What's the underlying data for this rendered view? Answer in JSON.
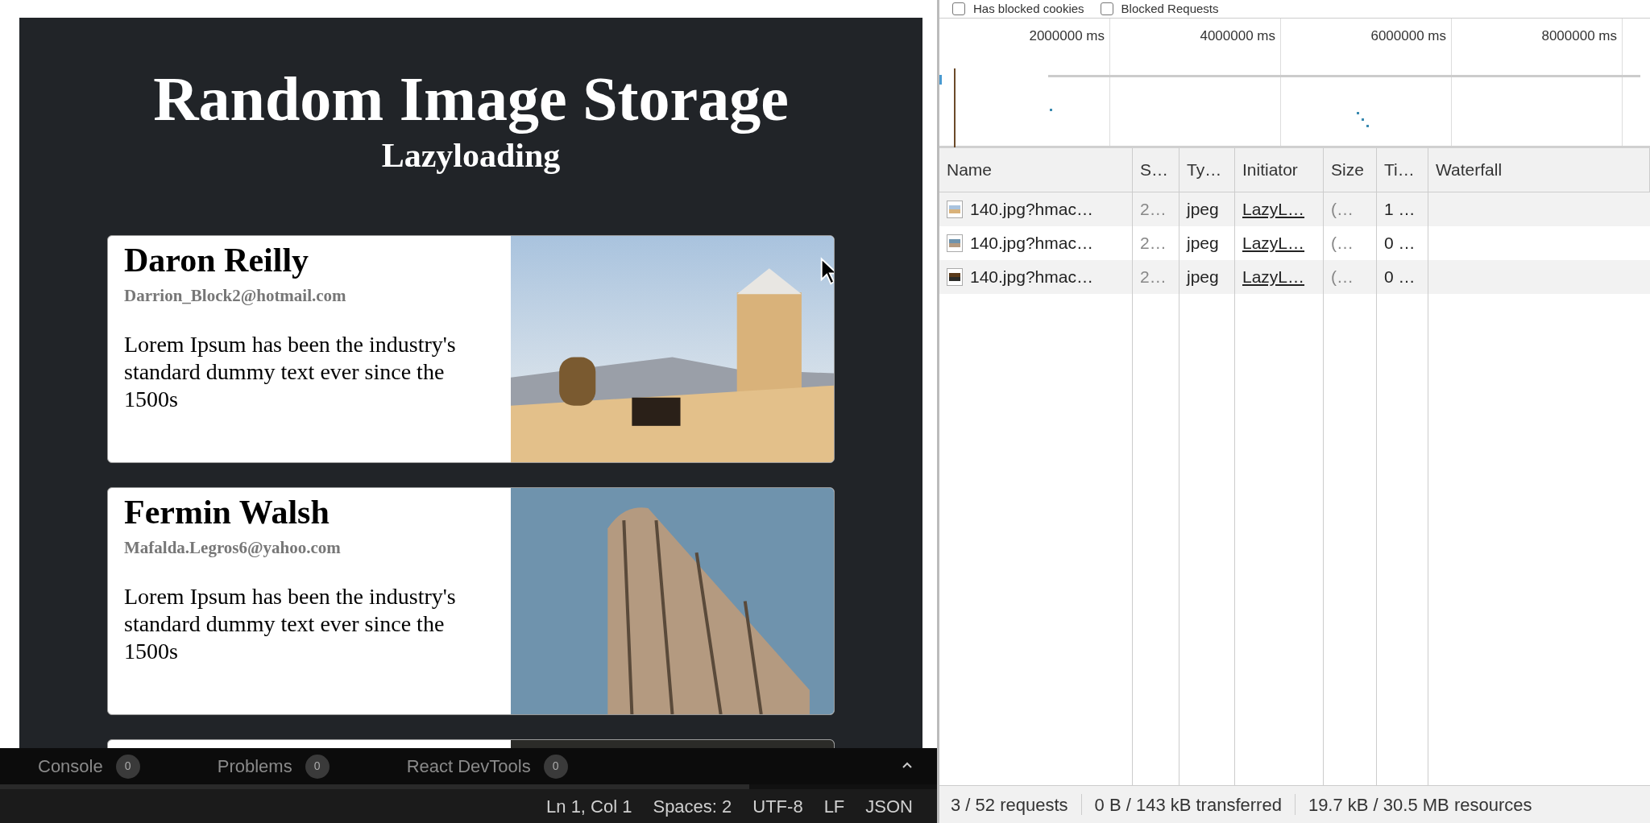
{
  "preview": {
    "title": "Random Image Storage",
    "subtitle": "Lazyloading",
    "cards": [
      {
        "kind": "full",
        "name": "Daron Reilly",
        "email": "Darrion_Block2@hotmail.com",
        "text": "Lorem Ipsum has been the industry's standard dummy text ever since the 1500s"
      },
      {
        "kind": "full",
        "name": "Fermin Walsh",
        "email": "Mafalda.Legros6@yahoo.com",
        "text": "Lorem Ipsum has been the industry's standard dummy text ever since the 1500s"
      },
      {
        "kind": "cut_off"
      }
    ]
  },
  "bottom_panel": {
    "tabs": [
      {
        "label": "Console",
        "count": "0"
      },
      {
        "label": "Problems",
        "count": "0"
      },
      {
        "label": "React DevTools",
        "count": "0"
      }
    ]
  },
  "status_bar": [
    "Ln 1, Col 1",
    "Spaces: 2",
    "UTF-8",
    "LF",
    "JSON"
  ],
  "devtools": {
    "filters": [
      {
        "label": "Has blocked cookies",
        "checked": false
      },
      {
        "label": "Blocked Requests",
        "checked": false
      }
    ],
    "timeline_ticks": [
      "2000000 ms",
      "4000000 ms",
      "6000000 ms",
      "8000000 ms"
    ],
    "columns": [
      "Name",
      "S…",
      "Ty…",
      "Initiator",
      "Size",
      "Ti…",
      "Waterfall"
    ],
    "rows": [
      {
        "name": "140.jpg?hmac…",
        "status": "2…",
        "type": "jpeg",
        "initiator": "LazyL…",
        "size": "(…",
        "time": "1 …"
      },
      {
        "name": "140.jpg?hmac…",
        "status": "2…",
        "type": "jpeg",
        "initiator": "LazyL…",
        "size": "(…",
        "time": "0 …"
      },
      {
        "name": "140.jpg?hmac…",
        "status": "2…",
        "type": "jpeg",
        "initiator": "LazyL…",
        "size": "(…",
        "time": "0 …"
      }
    ],
    "summary": [
      "3 / 52 requests",
      "0 B / 143 kB transferred",
      "19.7 kB / 30.5 MB resources"
    ]
  }
}
